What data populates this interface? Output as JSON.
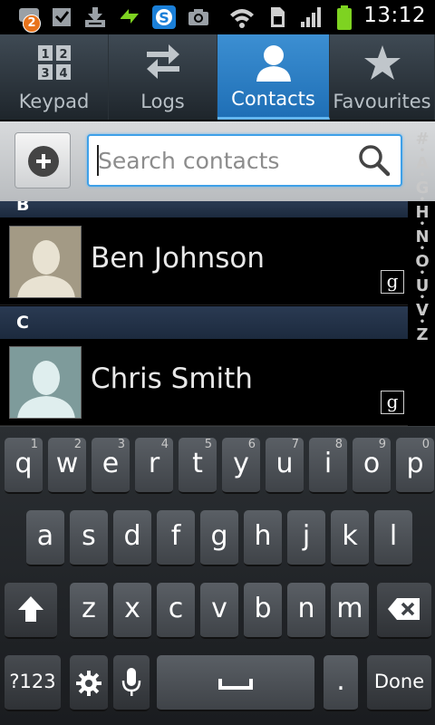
{
  "status_bar": {
    "notification_badge": "2",
    "time": "13:12",
    "icons": [
      "chat-notification-icon",
      "checkbox-icon",
      "download-icon",
      "sync-icon",
      "skype-icon",
      "camera-icon",
      "wifi-icon",
      "sim-icon",
      "signal-icon",
      "battery-icon"
    ]
  },
  "tabs": [
    {
      "label": "Keypad",
      "icon": "keypad-icon",
      "active": false
    },
    {
      "label": "Logs",
      "icon": "logs-arrows-icon",
      "active": false
    },
    {
      "label": "Contacts",
      "icon": "person-icon",
      "active": true
    },
    {
      "label": "Favourites",
      "icon": "star-icon",
      "active": false
    }
  ],
  "search": {
    "placeholder": "Search contacts",
    "value": ""
  },
  "index_letters": [
    "#",
    "A",
    "G",
    "H",
    "N",
    "O",
    "U",
    "V",
    "Z"
  ],
  "sections": [
    {
      "header": "B",
      "contacts": [
        {
          "name": "Ben Johnson",
          "account": "g"
        }
      ]
    },
    {
      "header": "C",
      "contacts": [
        {
          "name": "Chris Smith",
          "account": "g"
        }
      ]
    }
  ],
  "keyboard": {
    "row1": [
      {
        "k": "q",
        "h": "1"
      },
      {
        "k": "w",
        "h": "2"
      },
      {
        "k": "e",
        "h": "3"
      },
      {
        "k": "r",
        "h": "4"
      },
      {
        "k": "t",
        "h": "5"
      },
      {
        "k": "y",
        "h": "6"
      },
      {
        "k": "u",
        "h": "7"
      },
      {
        "k": "i",
        "h": "8"
      },
      {
        "k": "o",
        "h": "9"
      },
      {
        "k": "p",
        "h": "0"
      }
    ],
    "row2": [
      "a",
      "s",
      "d",
      "f",
      "g",
      "h",
      "j",
      "k",
      "l"
    ],
    "row3": [
      "z",
      "x",
      "c",
      "v",
      "b",
      "n",
      "m"
    ],
    "symbols_label": "?123",
    "done_label": "Done",
    "period_label": "."
  },
  "colors": {
    "active_tab": "#2f80c8",
    "search_border": "#3ea0e8",
    "section_header": "#23324a"
  }
}
